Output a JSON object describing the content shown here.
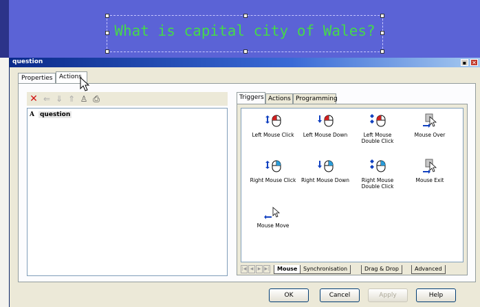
{
  "slide": {
    "title": "What is capital city of Wales?"
  },
  "window": {
    "title": "question"
  },
  "outer_tabs": [
    {
      "label": "Properties",
      "active": false
    },
    {
      "label": "Actions",
      "active": true
    }
  ],
  "toolbar_icons": [
    "delete-icon",
    "arrow-left-icon",
    "arrow-down-icon",
    "arrow-up-icon",
    "person-icon",
    "print-icon"
  ],
  "list": {
    "type_glyph": "A",
    "item": "question"
  },
  "inner_tabs": [
    {
      "label": "Triggers",
      "active": true
    },
    {
      "label": "Actions",
      "active": false
    },
    {
      "label": "Programming",
      "active": false
    }
  ],
  "triggers": [
    {
      "line1": "Left Mouse Click",
      "line2": "",
      "icon": "left-mouse-click-icon"
    },
    {
      "line1": "Left Mouse Down",
      "line2": "",
      "icon": "left-mouse-down-icon"
    },
    {
      "line1": "Left Mouse",
      "line2": "Double Click",
      "icon": "left-mouse-double-click-icon"
    },
    {
      "line1": "Mouse Over",
      "line2": "",
      "icon": "mouse-over-icon"
    },
    {
      "line1": "Right Mouse Click",
      "line2": "",
      "icon": "right-mouse-click-icon"
    },
    {
      "line1": "Right Mouse Down",
      "line2": "",
      "icon": "right-mouse-down-icon"
    },
    {
      "line1": "Right Mouse",
      "line2": "Double Click",
      "icon": "right-mouse-double-click-icon"
    },
    {
      "line1": "Mouse Exit",
      "line2": "",
      "icon": "mouse-exit-icon"
    },
    {
      "line1": "Mouse Move",
      "line2": "",
      "icon": "mouse-move-icon"
    }
  ],
  "bottom_tabs": [
    {
      "label": "Mouse",
      "active": true
    },
    {
      "label": "Synchronisation",
      "active": false
    },
    {
      "label": "Drag & Drop",
      "active": false
    },
    {
      "label": "Advanced",
      "active": false
    }
  ],
  "buttons": {
    "ok": "OK",
    "cancel": "Cancel",
    "apply": "Apply",
    "help": "Help"
  },
  "colors": {
    "slide_bg": "#5b63d6",
    "title_text": "#45d94a",
    "titlebar": "#0a2a8a"
  }
}
